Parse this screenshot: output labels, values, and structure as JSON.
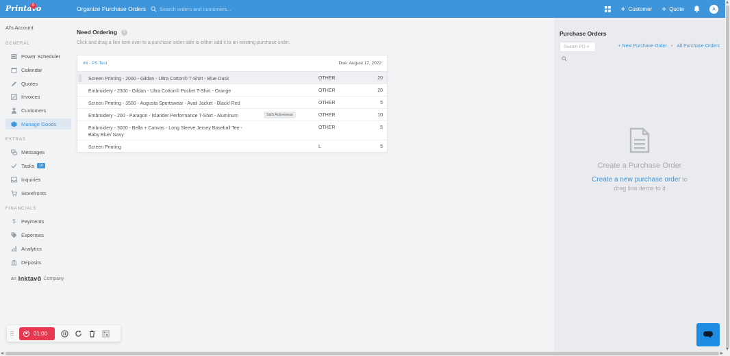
{
  "app": {
    "logo": "Printavo",
    "logo_badge": "6",
    "page_title": "Organize Purchase Orders"
  },
  "search": {
    "placeholder": "Search orders and customers..."
  },
  "topbar": {
    "customer_label": "Customer",
    "quote_label": "Quote",
    "avatar_initial": "A"
  },
  "sidebar": {
    "account": "Al's Account",
    "sections": {
      "general": "GENERAL",
      "extras": "EXTRAS",
      "financials": "FINANCIALS"
    },
    "general_items": [
      {
        "label": "Power Scheduler",
        "icon": "scheduler-icon"
      },
      {
        "label": "Calendar",
        "icon": "calendar-icon"
      },
      {
        "label": "Quotes",
        "icon": "pencil-icon"
      },
      {
        "label": "Invoices",
        "icon": "invoice-icon"
      },
      {
        "label": "Customers",
        "icon": "person-icon"
      },
      {
        "label": "Manage Goods",
        "icon": "box-icon"
      }
    ],
    "extras_items": [
      {
        "label": "Messages",
        "icon": "messages-icon"
      },
      {
        "label": "Tasks",
        "icon": "check-icon",
        "badge": "10"
      },
      {
        "label": "Inquiries",
        "icon": "inbox-icon"
      },
      {
        "label": "Storefronts",
        "icon": "cart-icon"
      }
    ],
    "financials_items": [
      {
        "label": "Payments",
        "icon": "dollar-icon"
      },
      {
        "label": "Expenses",
        "icon": "tag-icon"
      },
      {
        "label": "Analytics",
        "icon": "bar-chart-icon"
      },
      {
        "label": "Deposits",
        "icon": "bank-icon"
      }
    ],
    "company_prefix": "an",
    "company_brand": "Inktavō",
    "company_suffix": "Company"
  },
  "main": {
    "title": "Need Ordering",
    "help": "?",
    "subtitle": "Click and drag a line item over to a purchase order side to either add it to an existing purchase order.",
    "order": {
      "link": "#6 - PS Test",
      "due": "Due: August 17, 2022",
      "rows": [
        {
          "desc": "Screen Printing - 2000 - Gildan - Ultra Cotton® T-Shirt - Blue Dusk",
          "tag": "",
          "size": "OTHER",
          "qty": "20"
        },
        {
          "desc": "Embroidery - 2300 - Gildan - Ultra Cotton® Pocket T-Shirt - Orange",
          "tag": "",
          "size": "OTHER",
          "qty": "20"
        },
        {
          "desc": "Screen Printing - 3500 - Augusta Sportswear - Avail Jacket - Black/ Red",
          "tag": "",
          "size": "OTHER",
          "qty": "5"
        },
        {
          "desc": "Embroidery - 200 - Paragon - Islander Performance T-Shirt - Aluminum",
          "tag": "S&S Activewear",
          "size": "OTHER",
          "qty": "10"
        },
        {
          "desc": "Embroidery - 3000 - Bella + Canvas - Long Sleeve Jersey Baseball Tee - Baby Blue/ Navy",
          "tag": "",
          "size": "OTHER",
          "qty": "5"
        },
        {
          "desc": "Screen Printing",
          "tag": "",
          "size": "L",
          "qty": "5"
        }
      ]
    }
  },
  "purchase_orders": {
    "title": "Purchase Orders",
    "search_placeholder": "Search PO #",
    "new_link": "+ New Purchase Order",
    "separator": "•",
    "all_link": "All Purchase Orders",
    "empty_title": "Create a Purchase Order",
    "empty_link": "Create a new purchase order",
    "empty_after_link": "to",
    "empty_line2": "drag line items to it"
  },
  "recorder": {
    "time": "01:00"
  },
  "colors": {
    "brand": "#3f95d9",
    "record": "#e8384f",
    "chat": "#1e8ce3"
  }
}
